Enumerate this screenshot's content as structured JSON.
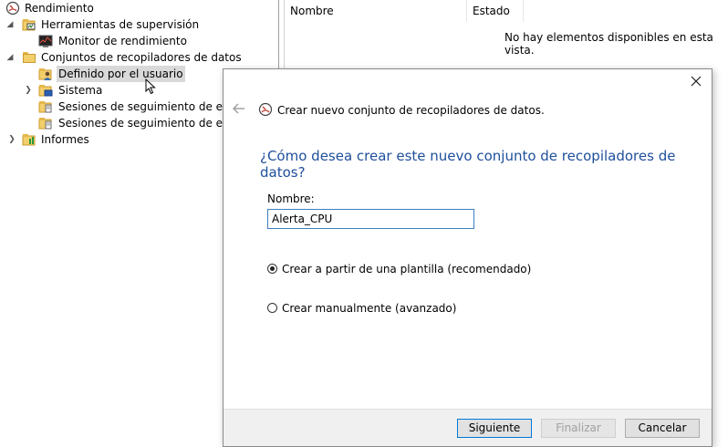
{
  "tree": {
    "items": [
      {
        "label": "Rendimiento",
        "icon": "performance-gauge-icon"
      },
      {
        "label": "Herramientas de supervisión",
        "icon": "folder-monitor-icon"
      },
      {
        "label": "Monitor de rendimiento",
        "icon": "chart-icon"
      },
      {
        "label": "Conjuntos de recopiladores de datos",
        "icon": "folder-icon"
      },
      {
        "label": "Definido por el usuario",
        "icon": "user-folder-icon"
      },
      {
        "label": "Sistema",
        "icon": "system-folder-icon"
      },
      {
        "label": "Sesiones de seguimiento de evento",
        "icon": "folder-doc-icon"
      },
      {
        "label": "Sesiones de seguimiento de evento",
        "icon": "folder-doc-icon"
      },
      {
        "label": "Informes",
        "icon": "report-folder-icon"
      }
    ]
  },
  "list": {
    "columns": [
      "Nombre",
      "Estado"
    ],
    "empty_message": "No hay elementos disponibles en esta vista."
  },
  "wizard": {
    "title": "Crear nuevo conjunto de recopiladores de datos.",
    "heading": "¿Cómo desea crear este nuevo conjunto de recopiladores de datos?",
    "name_label": "Nombre:",
    "name_value": "Alerta_CPU",
    "options": [
      {
        "label": "Crear a partir de una plantilla (recomendado)",
        "checked": true
      },
      {
        "label": "Crear manualmente (avanzado)",
        "checked": false
      }
    ],
    "buttons": {
      "next": "Siguiente",
      "finish": "Finalizar",
      "cancel": "Cancelar"
    }
  },
  "colors": {
    "heading": "#1e4f9c",
    "input_border": "#3c7fc1",
    "primary_border": "#0078d7",
    "selection": "#d9d9d9"
  }
}
